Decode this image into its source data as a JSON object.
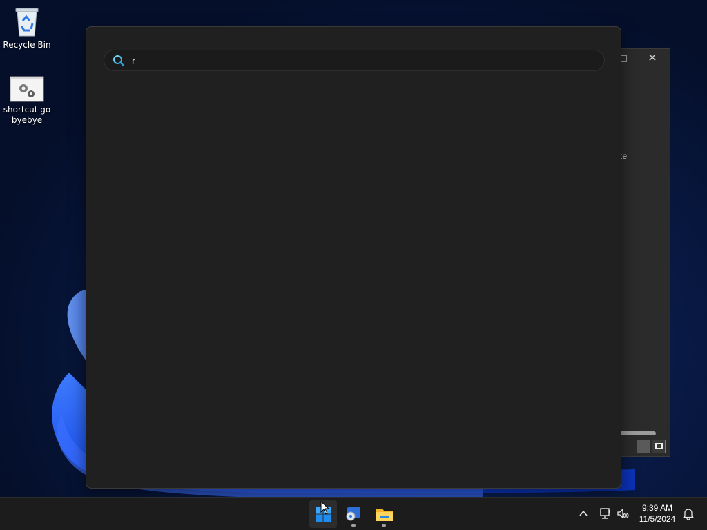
{
  "desktop": {
    "icons": [
      {
        "label": "Recycle Bin",
        "icon": "recycle-bin-icon"
      },
      {
        "label": "shortcut go byebye",
        "icon": "settings-shortcut-icon"
      }
    ]
  },
  "background_window": {
    "partial_text": "ze"
  },
  "search": {
    "query": "r",
    "icon": "search-icon"
  },
  "taskbar": {
    "apps": [
      {
        "name": "start",
        "icon": "windows-logo-icon"
      },
      {
        "name": "media-app",
        "icon": "media-player-icon"
      },
      {
        "name": "file-explorer",
        "icon": "folder-icon"
      }
    ],
    "tray": {
      "chevron": "^",
      "time": "9:39 AM",
      "date": "11/5/2024"
    }
  },
  "colors": {
    "flyout_bg": "#202020",
    "taskbar_bg": "#1c1c1c",
    "accent_blue": "#1a5cff"
  }
}
